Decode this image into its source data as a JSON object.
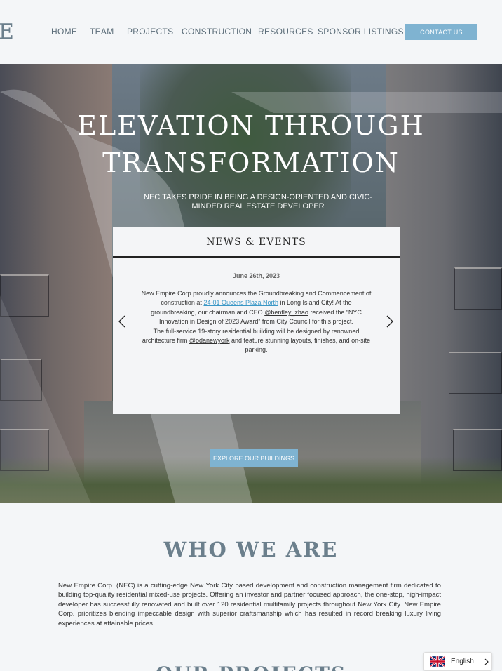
{
  "header": {
    "logo_fragment": "E",
    "nav": [
      "HOME",
      "TEAM",
      "PROJECTS",
      "CONSTRUCTION",
      "RESOURCES",
      "SPONSOR LISTINGS"
    ],
    "contact_label": "CONTACT US"
  },
  "hero": {
    "title_line1": "ELEVATION THROUGH",
    "title_line2": "TRANSFORMATION",
    "subtitle": "NEC TAKES PRIDE IN BEING A DESIGN-ORIENTED AND CIVIC-MINDED REAL ESTATE DEVELOPER",
    "explore_label": "EXPLORE OUR BUILDINGS"
  },
  "news": {
    "heading": "NEWS & EVENTS",
    "date": "June 26th, 2023",
    "p1_a": "New Empire Corp proudly announces the Groundbreaking and Commencement of construction at ",
    "p1_link": "24-01 Queens Plaza North",
    "p1_b": " in Long Island City! At the groundbreaking, our chairman and CEO ",
    "p1_handle": "@bentley_zhao",
    "p1_c": " received the “NYC Innovation in Design of 2023 Award” from City Council for this project.",
    "p2_a": "The full-service 19-story residential building will be designed by renowned architecture firm ",
    "p2_handle": "@odanewyork",
    "p2_b": " and feature stunning layouts, finishes, and on-site parking."
  },
  "who": {
    "title": "WHO WE ARE",
    "text": "New Empire Corp. (NEC) is a cutting-edge New York City based development and construction management firm dedicated to building top-quality residential mixed-use projects. Offering an investor and partner focused approach, the one-stop, high-impact developer has successfully renovated and built over 120 residential multifamily projects throughout New York City. New Empire Corp. prioritizes blending impeccable design with superior craftsmanship which has resulted in record breaking luxury living experiences at attainable prices"
  },
  "next_section": {
    "title_fragment": "OUR PROJECTS"
  },
  "language": {
    "label": "English",
    "flag_icon": "uk-flag-icon"
  },
  "colors": {
    "accent": "#7fb3d1",
    "heading_gray": "#6b7f8c",
    "link_blue": "#3a97c6"
  }
}
